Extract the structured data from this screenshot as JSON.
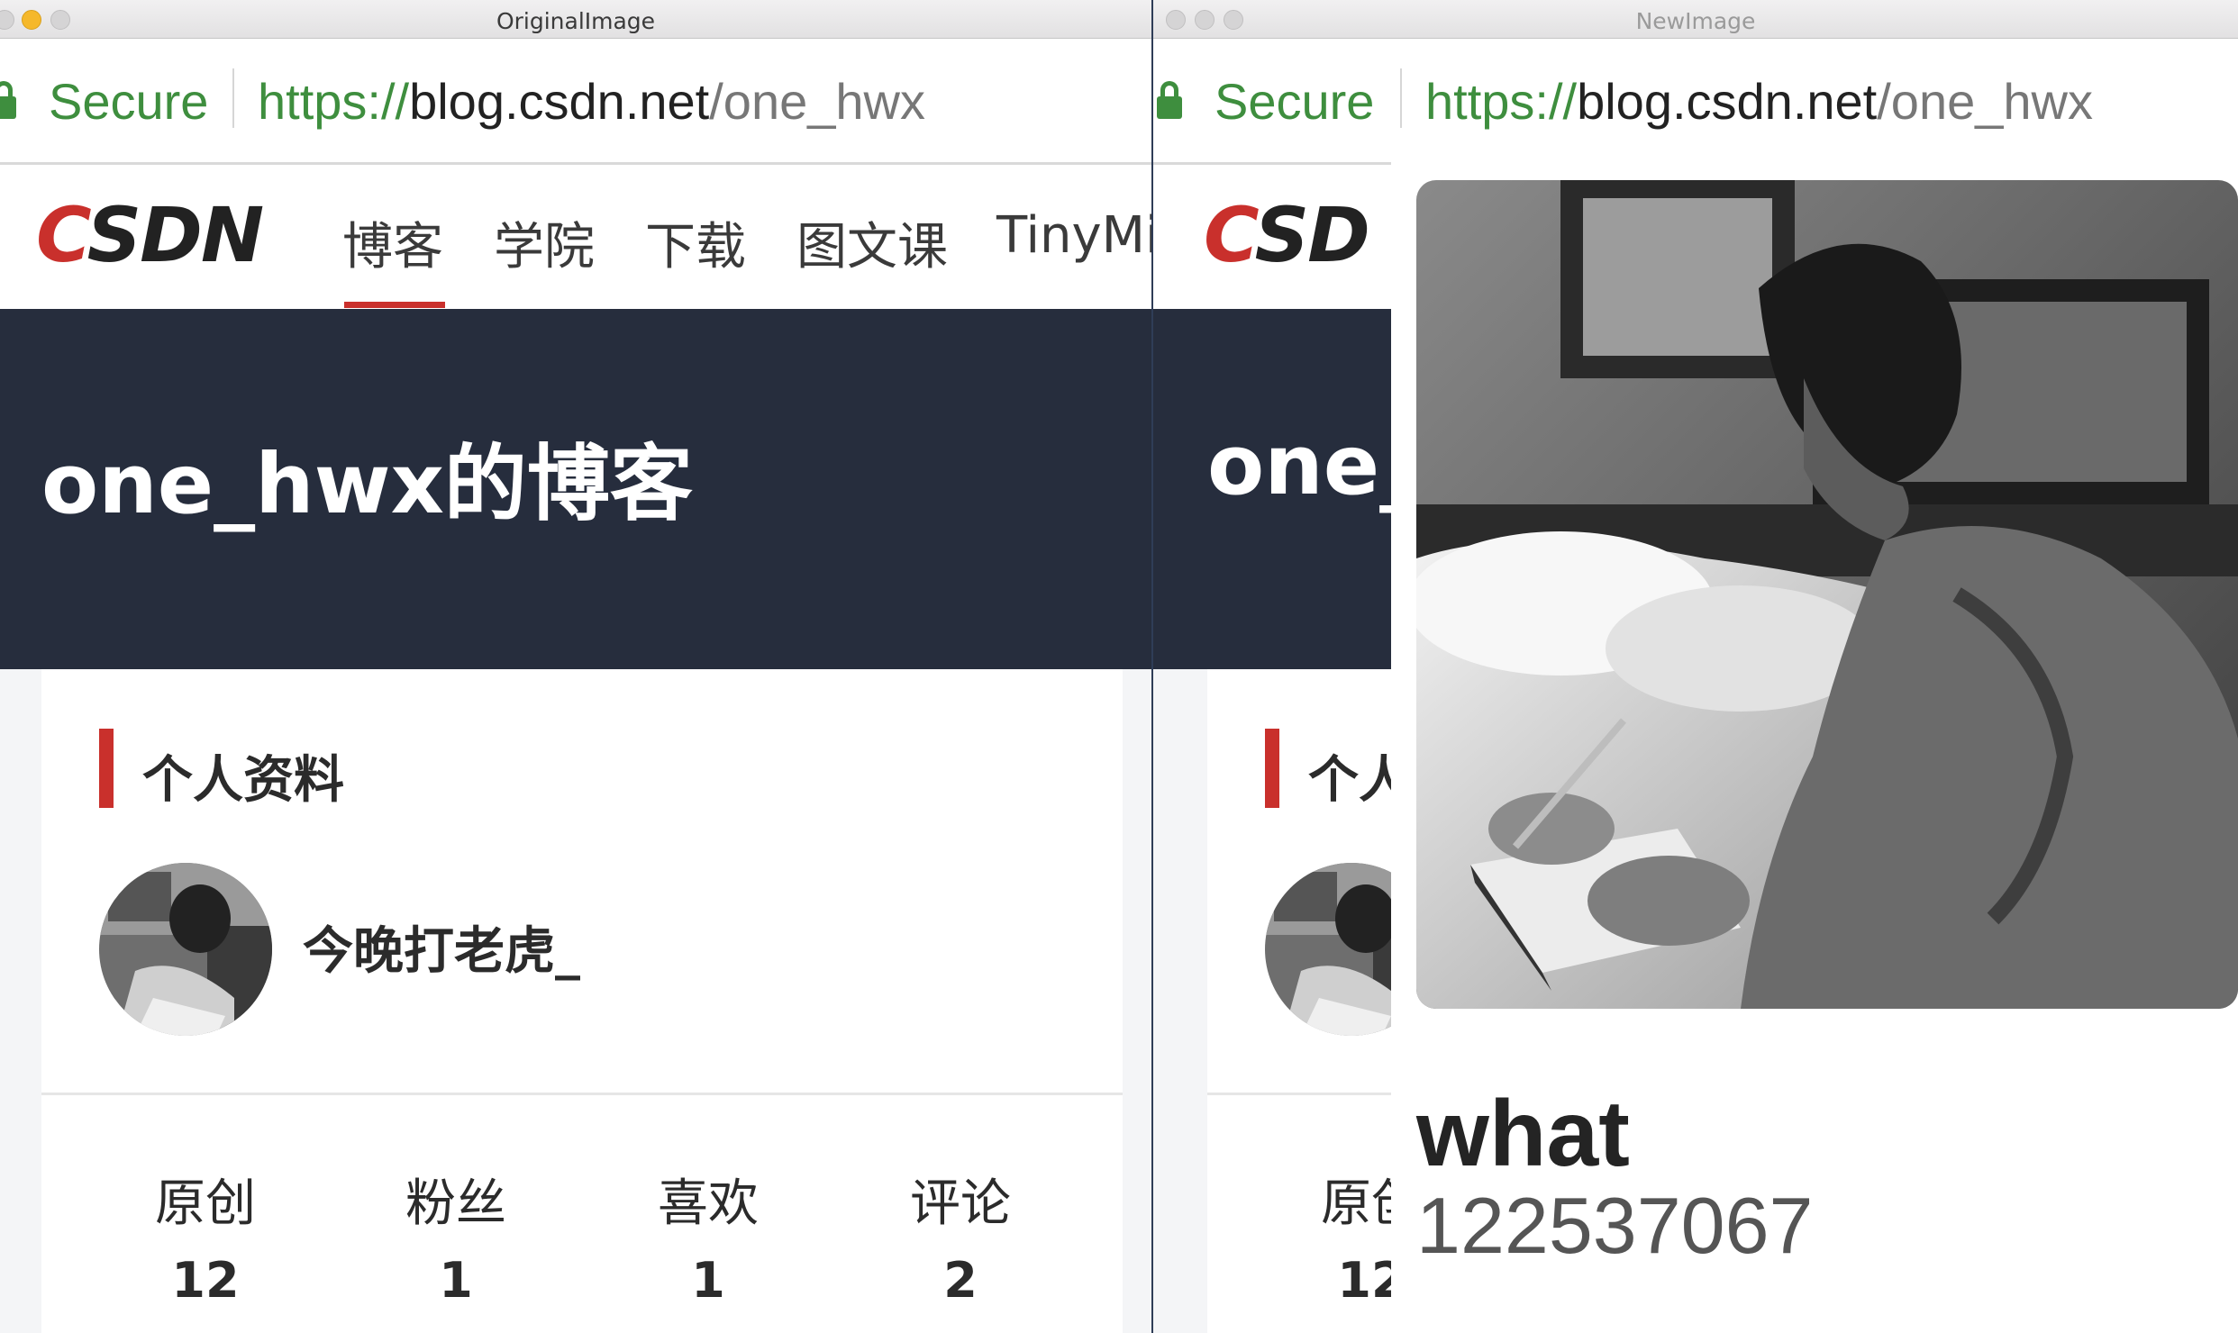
{
  "windows": {
    "original": {
      "title": "OriginalImage",
      "address": {
        "secure_label": "Secure",
        "url_scheme": "https://",
        "url_host": "blog.csdn.net",
        "url_path": "/one_hwx"
      },
      "nav": {
        "logo": "CSDN",
        "items": [
          "博客",
          "学院",
          "下载",
          "图文课",
          "TinyMi"
        ],
        "active_index": 0
      },
      "banner": {
        "title": "one_hwx的博客"
      },
      "profile": {
        "section_title": "个人资料",
        "username": "今晚打老虎_",
        "stats": [
          {
            "label": "原创",
            "value": "12"
          },
          {
            "label": "粉丝",
            "value": "1"
          },
          {
            "label": "喜欢",
            "value": "1"
          },
          {
            "label": "评论",
            "value": "2"
          }
        ]
      }
    },
    "new": {
      "title": "NewImage",
      "address": {
        "secure_label": "Secure",
        "url_scheme": "https://",
        "url_host": "blog.csdn.net",
        "url_path": "/one_hwx"
      },
      "nav": {
        "logo_partial": "CSD"
      },
      "banner": {
        "title_partial": "one_"
      },
      "profile": {
        "section_title_partial": "个人",
        "stat_label_partial": "原创",
        "stat_value_partial": "12"
      },
      "overlay": {
        "name": "what",
        "id": "122537067"
      }
    }
  },
  "colors": {
    "secure_green": "#3e8e3e",
    "brand_red": "#c9302c",
    "banner_bg": "#262d3d",
    "page_bg": "#f4f5f7"
  },
  "icons": [
    "lock-icon",
    "csdn-logo",
    "avatar-photo",
    "profile-photo"
  ]
}
